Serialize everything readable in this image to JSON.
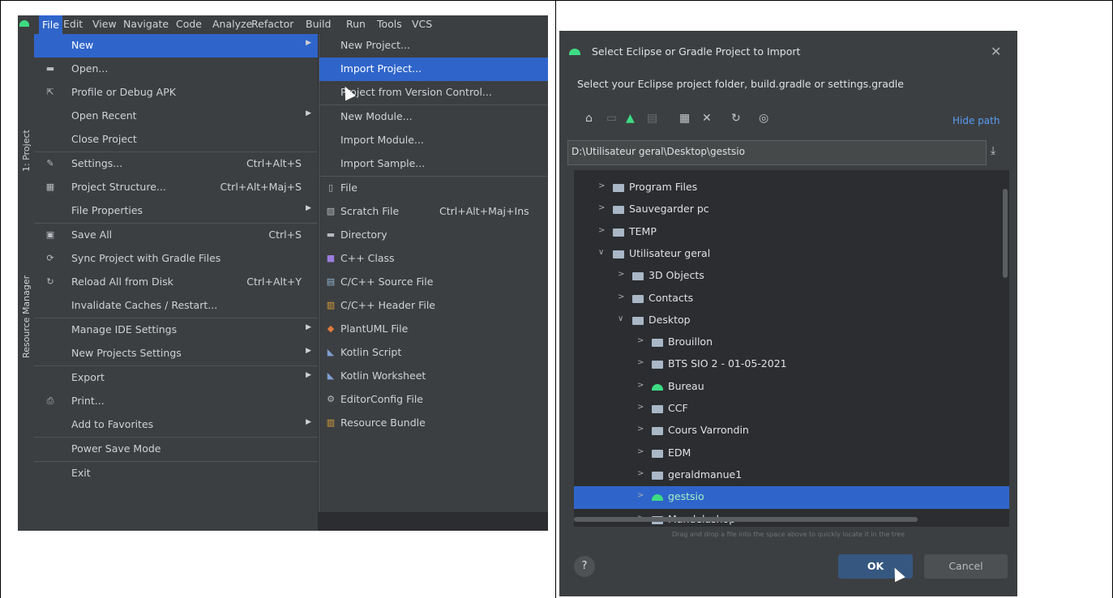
{
  "menubar": [
    "File",
    "Edit",
    "View",
    "Navigate",
    "Code",
    "Analyze",
    "Refactor",
    "Build",
    "Run",
    "Tools",
    "VCS"
  ],
  "toolwindows": [
    "1: Project",
    "Resource Manager"
  ],
  "file_menu": [
    {
      "label": "New",
      "shortcut": "",
      "arrow": true,
      "icon": "",
      "highlight": true
    },
    {
      "label": "Open...",
      "shortcut": "",
      "icon": "folder-icon"
    },
    {
      "label": "Profile or Debug APK",
      "shortcut": "",
      "icon": "profile-icon"
    },
    {
      "label": "Open Recent",
      "shortcut": "",
      "arrow": true,
      "icon": ""
    },
    {
      "label": "Close Project",
      "shortcut": "",
      "icon": ""
    },
    {
      "label": "Settings...",
      "shortcut": "Ctrl+Alt+S",
      "icon": "wrench-icon",
      "sep": true
    },
    {
      "label": "Project Structure...",
      "shortcut": "Ctrl+Alt+Maj+S",
      "icon": "structure-icon"
    },
    {
      "label": "File Properties",
      "shortcut": "",
      "arrow": true,
      "icon": ""
    },
    {
      "label": "Save All",
      "shortcut": "Ctrl+S",
      "icon": "save-icon",
      "sep": true
    },
    {
      "label": "Sync Project with Gradle Files",
      "shortcut": "",
      "icon": "sync-icon"
    },
    {
      "label": "Reload All from Disk",
      "shortcut": "Ctrl+Alt+Y",
      "icon": "reload-icon"
    },
    {
      "label": "Invalidate Caches / Restart...",
      "shortcut": "",
      "icon": ""
    },
    {
      "label": "Manage IDE Settings",
      "shortcut": "",
      "arrow": true,
      "icon": "",
      "sep": true
    },
    {
      "label": "New Projects Settings",
      "shortcut": "",
      "arrow": true,
      "icon": ""
    },
    {
      "label": "Export",
      "shortcut": "",
      "arrow": true,
      "icon": "",
      "sep": true
    },
    {
      "label": "Print...",
      "shortcut": "",
      "icon": "print-icon"
    },
    {
      "label": "Add to Favorites",
      "shortcut": "",
      "arrow": true,
      "icon": ""
    },
    {
      "label": "Power Save Mode",
      "shortcut": "",
      "icon": "",
      "sep": true
    },
    {
      "label": "Exit",
      "shortcut": "",
      "icon": "",
      "sep": true
    }
  ],
  "new_submenu": [
    {
      "label": "New Project...",
      "icon": ""
    },
    {
      "label": "Import Project...",
      "icon": "",
      "highlight": true
    },
    {
      "label": "Project from Version Control...",
      "icon": ""
    },
    {
      "label": "New Module...",
      "icon": "",
      "sep": true
    },
    {
      "label": "Import Module...",
      "icon": ""
    },
    {
      "label": "Import Sample...",
      "icon": ""
    },
    {
      "label": "File",
      "icon": "file-icon",
      "sep": true
    },
    {
      "label": "Scratch File",
      "shortcut": "Ctrl+Alt+Maj+Ins",
      "icon": "scratch-file-icon"
    },
    {
      "label": "Directory",
      "icon": "folder-icon"
    },
    {
      "label": "C++ Class",
      "icon": "cpp-class-icon"
    },
    {
      "label": "C/C++ Source File",
      "icon": "cpp-source-icon"
    },
    {
      "label": "C/C++ Header File",
      "icon": "cpp-header-icon"
    },
    {
      "label": "PlantUML File",
      "icon": "plantuml-icon"
    },
    {
      "label": "Kotlin Script",
      "icon": "kotlin-icon"
    },
    {
      "label": "Kotlin Worksheet",
      "icon": "kotlin-icon"
    },
    {
      "label": "EditorConfig File",
      "icon": "gear-icon"
    },
    {
      "label": "Resource Bundle",
      "icon": "resource-bundle-icon"
    }
  ],
  "dialog": {
    "title": "Select Eclipse or Gradle Project to Import",
    "description": "Select your Eclipse project folder, build.gradle or settings.gradle",
    "hide_path": "Hide path",
    "path": "D:\\Utilisateur geral\\Desktop\\gestsio",
    "drop_hint": "Drag and drop a file into the space above to quickly locate it in the tree",
    "help": "?",
    "ok": "OK",
    "cancel": "Cancel"
  },
  "tree": [
    {
      "name": "Program Files",
      "level": 0,
      "open": false
    },
    {
      "name": "Sauvegarder pc",
      "level": 0,
      "open": false
    },
    {
      "name": "TEMP",
      "level": 0,
      "open": false
    },
    {
      "name": "Utilisateur geral",
      "level": 0,
      "open": true
    },
    {
      "name": "3D Objects",
      "level": 1,
      "open": false
    },
    {
      "name": "Contacts",
      "level": 1,
      "open": false
    },
    {
      "name": "Desktop",
      "level": 1,
      "open": true
    },
    {
      "name": "Brouillon",
      "level": 2,
      "open": false
    },
    {
      "name": "BTS SIO 2 - 01-05-2021",
      "level": 2,
      "open": false
    },
    {
      "name": "Bureau",
      "level": 2,
      "open": false,
      "android": true
    },
    {
      "name": "CCF",
      "level": 2,
      "open": false
    },
    {
      "name": "Cours Varrondin",
      "level": 2,
      "open": false
    },
    {
      "name": "EDM",
      "level": 2,
      "open": false
    },
    {
      "name": "geraldmanue1",
      "level": 2,
      "open": false
    },
    {
      "name": "gestsio",
      "level": 2,
      "open": false,
      "android": true,
      "selected": true
    },
    {
      "name": "Mandelashop",
      "level": 2,
      "open": false
    }
  ],
  "colors": {
    "accent": "#2f65ca",
    "android": "#3ddc84",
    "link": "#589df6"
  }
}
